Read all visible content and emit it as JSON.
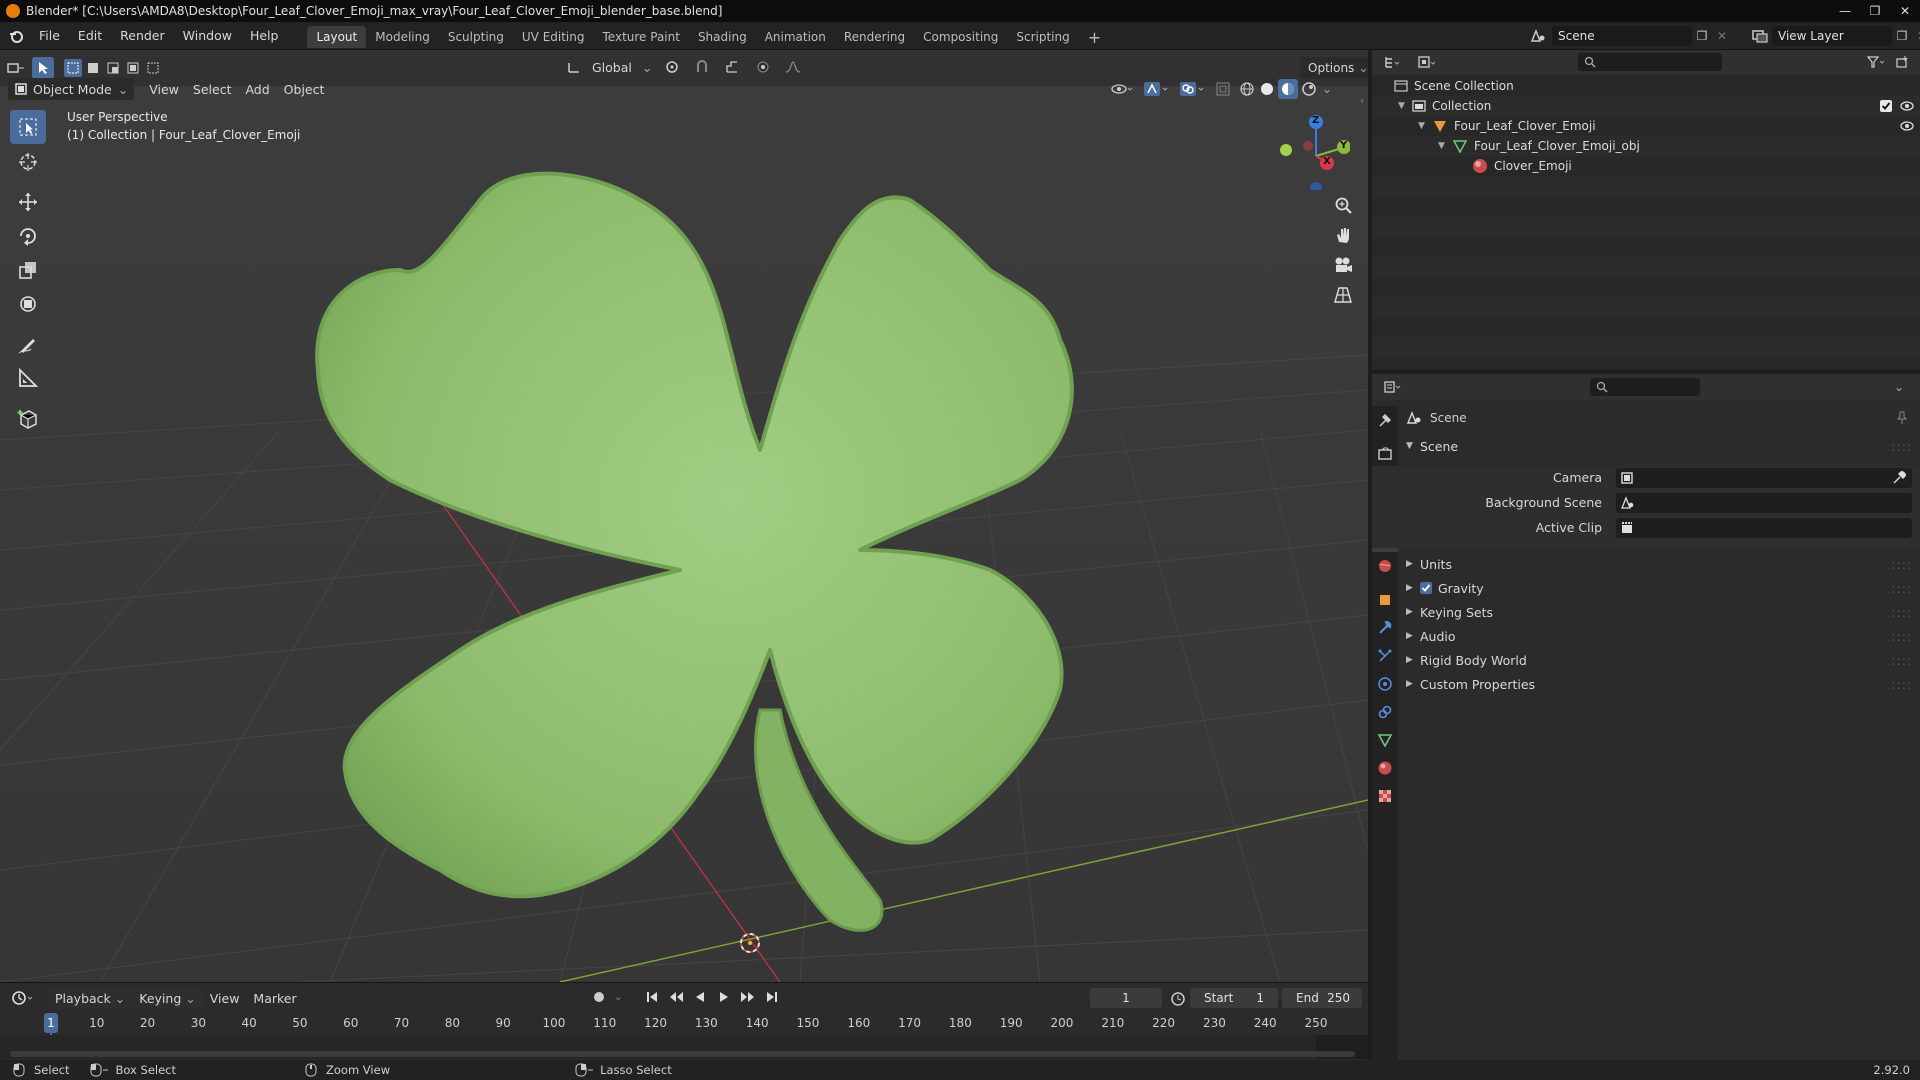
{
  "window": {
    "title": "Blender* [C:\\Users\\AMDA8\\Desktop\\Four_Leaf_Clover_Emoji_max_vray\\Four_Leaf_Clover_Emoji_blender_base.blend]"
  },
  "menu": [
    "File",
    "Edit",
    "Render",
    "Window",
    "Help"
  ],
  "workspaces": [
    {
      "label": "Layout",
      "active": true
    },
    {
      "label": "Modeling"
    },
    {
      "label": "Sculpting"
    },
    {
      "label": "UV Editing"
    },
    {
      "label": "Texture Paint"
    },
    {
      "label": "Shading"
    },
    {
      "label": "Animation"
    },
    {
      "label": "Rendering"
    },
    {
      "label": "Compositing"
    },
    {
      "label": "Scripting"
    }
  ],
  "topright": {
    "scene": "Scene",
    "view_layer": "View Layer"
  },
  "viewport_header": {
    "orientation": "Global",
    "options": "Options",
    "mode": "Object Mode",
    "menus": [
      "View",
      "Select",
      "Add",
      "Object"
    ]
  },
  "overlay_text": {
    "line1": "User Perspective",
    "line2": "(1) Collection | Four_Leaf_Clover_Emoji"
  },
  "gizmo": {
    "x": "X",
    "y": "Y",
    "z": "Z"
  },
  "outliner": {
    "root": "Scene Collection",
    "items": [
      {
        "label": "Collection"
      },
      {
        "label": "Four_Leaf_Clover_Emoji"
      },
      {
        "label": "Four_Leaf_Clover_Emoji_obj"
      },
      {
        "label": "Clover_Emoji"
      }
    ]
  },
  "properties": {
    "context": "Scene",
    "panel_title": "Scene",
    "fields": {
      "camera": "Camera",
      "background_scene": "Background Scene",
      "active_clip": "Active Clip"
    },
    "panels": [
      "Units",
      "Gravity",
      "Keying Sets",
      "Audio",
      "Rigid Body World",
      "Custom Properties"
    ],
    "gravity_checked": true
  },
  "timeline": {
    "menus": [
      "Playback",
      "Keying",
      "View",
      "Marker"
    ],
    "current_frame": "1",
    "start_label": "Start",
    "start": "1",
    "end_label": "End",
    "end": "250",
    "ticks": [
      "1",
      "10",
      "20",
      "30",
      "40",
      "50",
      "60",
      "70",
      "80",
      "90",
      "100",
      "110",
      "120",
      "130",
      "140",
      "150",
      "160",
      "170",
      "180",
      "190",
      "200",
      "210",
      "220",
      "230",
      "240",
      "250"
    ]
  },
  "statusbar": {
    "select": "Select",
    "box_select": "Box Select",
    "zoom_view": "Zoom View",
    "lasso_select": "Lasso Select",
    "version": "2.92.0"
  },
  "colors": {
    "accent": "#4b6d9c",
    "clover": "#8dbb6c",
    "x_axis": "#d9394a",
    "y_axis": "#8cb83b",
    "z_axis": "#3a7de0"
  }
}
